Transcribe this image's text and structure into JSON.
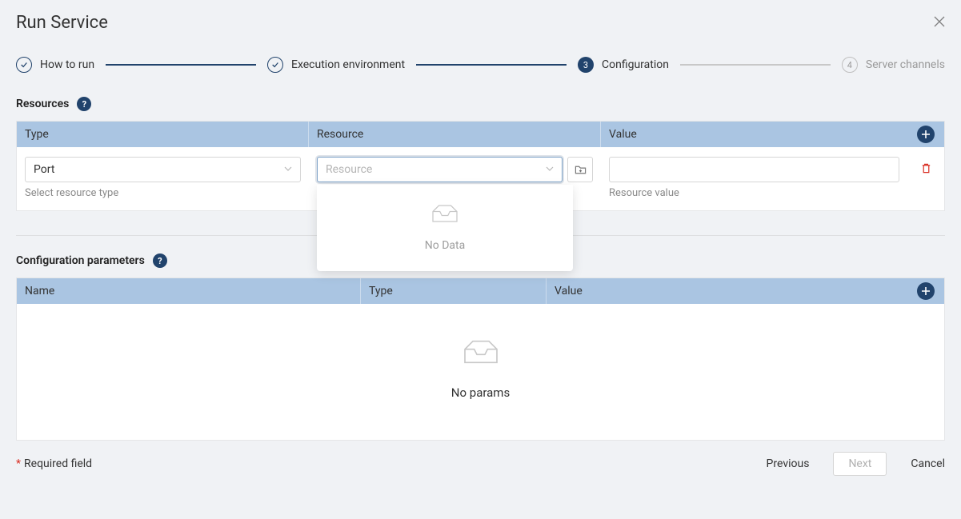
{
  "header": {
    "title": "Run Service"
  },
  "steps": {
    "howToRun": "How to run",
    "execEnv": "Execution environment",
    "config": "Configuration",
    "configNum": "3",
    "server": "Server channels",
    "serverNum": "4"
  },
  "resources": {
    "title": "Resources",
    "columns": {
      "type": "Type",
      "resource": "Resource",
      "value": "Value"
    },
    "row": {
      "typeValue": "Port",
      "typeHelper": "Select resource type",
      "resourcePlaceholder": "Resource",
      "valueHelper": "Resource value"
    },
    "dropdownEmpty": "No Data"
  },
  "params": {
    "title": "Configuration parameters",
    "columns": {
      "name": "Name",
      "type": "Type",
      "value": "Value"
    },
    "empty": "No params"
  },
  "footer": {
    "required": "Required field",
    "prev": "Previous",
    "next": "Next",
    "cancel": "Cancel"
  }
}
